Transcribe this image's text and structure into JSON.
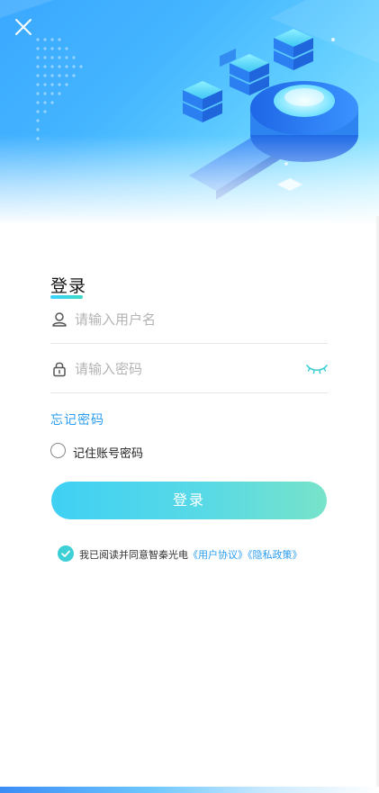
{
  "header": {
    "close_icon": "close-icon",
    "illustration": "isometric-servers-illustration"
  },
  "login": {
    "title": "登录",
    "username": {
      "placeholder": "请输入用户名",
      "value": "",
      "icon": "user-icon"
    },
    "password": {
      "placeholder": "请输入密码",
      "value": "",
      "icon": "lock-icon",
      "toggle_icon": "eye-closed-icon"
    },
    "forgot_label": "忘记密码",
    "remember_label": "记住账号密码",
    "remember_checked": false,
    "submit_label": "登录"
  },
  "agreement": {
    "checked": true,
    "text": "我已阅读并同意智秦光电",
    "user_agreement": "《用户协议》",
    "privacy_policy": "《隐私政策》"
  },
  "colors": {
    "accent_blue": "#2a9cf0",
    "accent_cyan": "#3dcfd6",
    "button_start": "#3fd0f3",
    "button_end": "#77e3c9"
  }
}
